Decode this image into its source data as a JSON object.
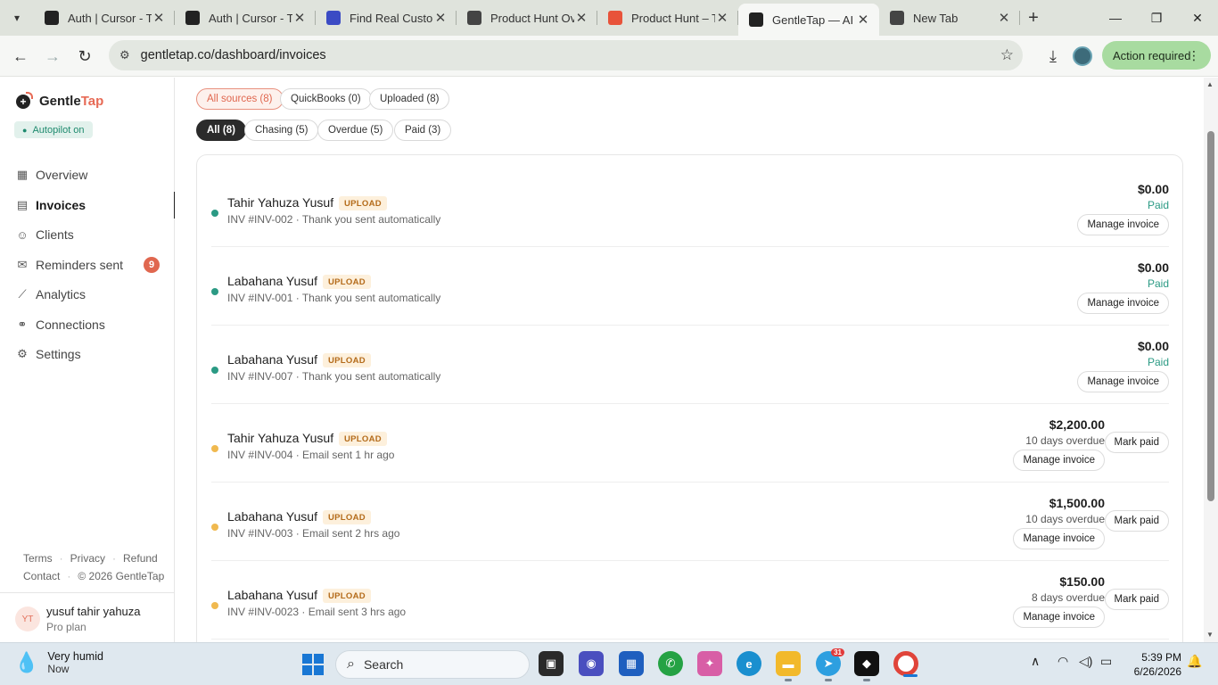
{
  "browser": {
    "tabs": [
      {
        "label": "Auth | Cursor - T",
        "icon": "cursor-icon",
        "color": "#222222"
      },
      {
        "label": "Auth | Cursor - T",
        "icon": "cursor-icon",
        "color": "#222222"
      },
      {
        "label": "Find Real Custom",
        "icon": "target-icon",
        "color": "#3b4bc4"
      },
      {
        "label": "Product Hunt Ov",
        "icon": "openai-icon",
        "color": "#444444"
      },
      {
        "label": "Product Hunt – T",
        "icon": "producthunt-icon",
        "color": "#e8533a"
      },
      {
        "label": "GentleTap — AI",
        "icon": "gentletap-icon",
        "color": "#222222",
        "active": true
      },
      {
        "label": "New Tab",
        "icon": "chrome-icon",
        "color": "#444444"
      }
    ],
    "url": "gentletap.co/dashboard/invoices",
    "action_required": "Action required"
  },
  "sidebar": {
    "brand_gentle": "Gentle",
    "brand_tap": "Tap",
    "autopilot": "Autopilot on",
    "nav": [
      {
        "label": "Overview",
        "icon": "grid-icon"
      },
      {
        "label": "Invoices",
        "icon": "document-icon",
        "active": true
      },
      {
        "label": "Clients",
        "icon": "users-icon"
      },
      {
        "label": "Reminders sent",
        "icon": "mail-icon",
        "badge": "9"
      },
      {
        "label": "Analytics",
        "icon": "trend-icon"
      },
      {
        "label": "Connections",
        "icon": "link-icon"
      },
      {
        "label": "Settings",
        "icon": "gear-icon"
      }
    ],
    "footer_row1": [
      "Terms",
      "Privacy",
      "Refund"
    ],
    "footer_row2": [
      "Contact",
      "© 2026 GentleTap"
    ],
    "user": {
      "initials": "YT",
      "name": "yusuf tahir yahuza",
      "plan": "Pro plan"
    }
  },
  "filters": {
    "sources": [
      "All sources (8)",
      "QuickBooks (0)",
      "Uploaded (8)"
    ],
    "statuses": [
      "All (8)",
      "Chasing (5)",
      "Overdue (5)",
      "Paid (3)"
    ]
  },
  "invoices": [
    {
      "client": "Tahir Yahuza Yusuf",
      "tag": "UPLOAD",
      "meta": "INV #INV-002 · Thank you sent automatically",
      "amount": "$0.00",
      "state": "Paid",
      "status": "paid",
      "manage": "Manage invoice"
    },
    {
      "client": "Labahana Yusuf",
      "tag": "UPLOAD",
      "meta": "INV #INV-001 · Thank you sent automatically",
      "amount": "$0.00",
      "state": "Paid",
      "status": "paid",
      "manage": "Manage invoice"
    },
    {
      "client": "Labahana Yusuf",
      "tag": "UPLOAD",
      "meta": "INV #INV-007 · Thank you sent automatically",
      "amount": "$0.00",
      "state": "Paid",
      "status": "paid",
      "manage": "Manage invoice"
    },
    {
      "client": "Tahir Yahuza Yusuf",
      "tag": "UPLOAD",
      "meta": "INV #INV-004 · Email sent 1 hr ago",
      "amount": "$2,200.00",
      "state": "10 days overdue",
      "status": "overdue",
      "manage": "Manage invoice",
      "mark": "Mark paid"
    },
    {
      "client": "Labahana Yusuf",
      "tag": "UPLOAD",
      "meta": "INV #INV-003 · Email sent 2 hrs ago",
      "amount": "$1,500.00",
      "state": "10 days overdue",
      "status": "overdue",
      "manage": "Manage invoice",
      "mark": "Mark paid"
    },
    {
      "client": "Labahana Yusuf",
      "tag": "UPLOAD",
      "meta": "INV #INV-0023 · Email sent 3 hrs ago",
      "amount": "$150.00",
      "state": "8 days overdue",
      "status": "overdue",
      "manage": "Manage invoice",
      "mark": "Mark paid"
    }
  ],
  "colors": {
    "paid_dot": "#2b9a84",
    "overdue_dot": "#f0b94f",
    "accent": "#e0674f"
  },
  "taskbar": {
    "weather_title": "Very humid",
    "weather_sub": "Now",
    "search": "Search",
    "telegram_badge": "31",
    "time": "5:39 PM",
    "date": "6/26/2026"
  }
}
